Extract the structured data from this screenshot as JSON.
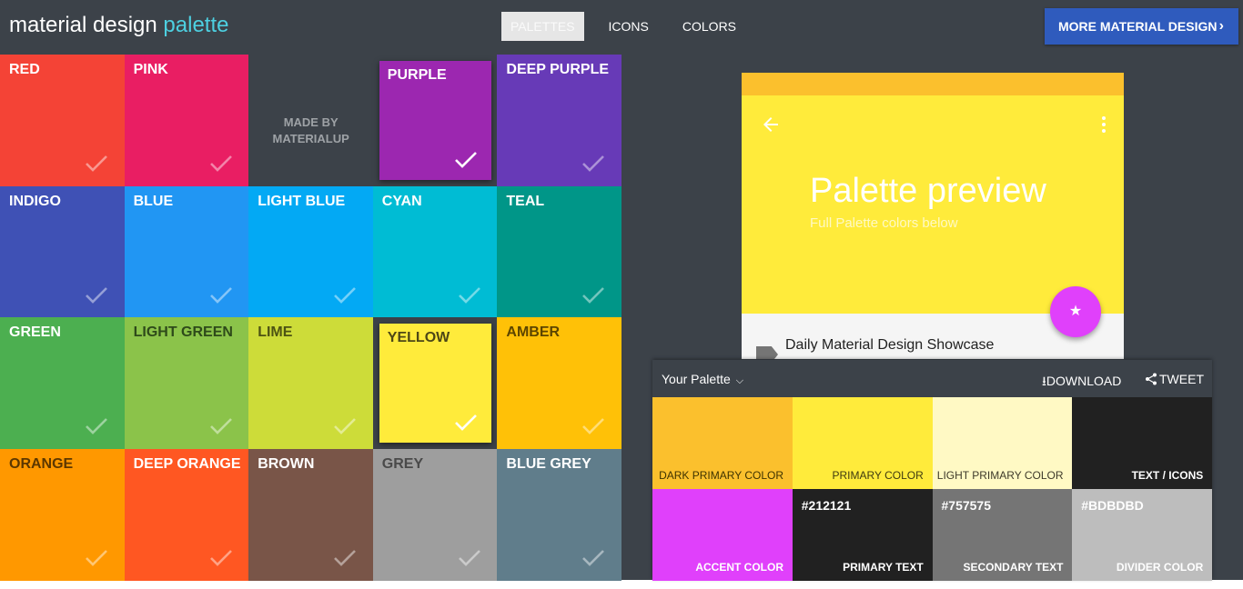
{
  "header": {
    "logo_main": "material design",
    "logo_accent": "palette",
    "nav": [
      {
        "label": "PALETTES",
        "active": true
      },
      {
        "label": "ICONS",
        "active": false
      },
      {
        "label": "COLORS",
        "active": false
      }
    ],
    "more_button": "MORE MATERIAL DESIGN"
  },
  "grid": {
    "tiles": [
      {
        "name": "RED",
        "color": "#f44336",
        "text_color": "#ffffff",
        "selected": false
      },
      {
        "name": "PINK",
        "color": "#e91e63",
        "text_color": "#ffffff",
        "selected": false
      },
      {
        "name": "",
        "color": "#3c4249",
        "text_color": "#9ea2a6",
        "selected": false,
        "made_by": [
          "MADE BY",
          "MATERIALUP"
        ]
      },
      {
        "name": "PURPLE",
        "color": "#9c27b0",
        "text_color": "#ffffff",
        "selected": true
      },
      {
        "name": "DEEP PURPLE",
        "color": "#673ab7",
        "text_color": "#ffffff",
        "selected": false
      },
      {
        "name": "INDIGO",
        "color": "#3f51b5",
        "text_color": "#ffffff",
        "selected": false
      },
      {
        "name": "BLUE",
        "color": "#2196f3",
        "text_color": "#ffffff",
        "selected": false
      },
      {
        "name": "LIGHT BLUE",
        "color": "#03a9f4",
        "text_color": "#ffffff",
        "selected": false
      },
      {
        "name": "CYAN",
        "color": "#00bcd4",
        "text_color": "#ffffff",
        "selected": false
      },
      {
        "name": "TEAL",
        "color": "#009688",
        "text_color": "#ffffff",
        "selected": false
      },
      {
        "name": "GREEN",
        "color": "#4caf50",
        "text_color": "#ffffff",
        "selected": false
      },
      {
        "name": "LIGHT GREEN",
        "color": "#8bc34a",
        "text_color": "#2e4a1a",
        "selected": false
      },
      {
        "name": "LIME",
        "color": "#cddc39",
        "text_color": "#4d5313",
        "selected": false
      },
      {
        "name": "YELLOW",
        "color": "#ffeb3b",
        "text_color": "#4d4716",
        "selected": true
      },
      {
        "name": "AMBER",
        "color": "#ffc107",
        "text_color": "#5c4500",
        "selected": false
      },
      {
        "name": "ORANGE",
        "color": "#ff9800",
        "text_color": "#5c3700",
        "selected": false
      },
      {
        "name": "DEEP ORANGE",
        "color": "#ff5722",
        "text_color": "#ffffff",
        "selected": false
      },
      {
        "name": "BROWN",
        "color": "#795548",
        "text_color": "#ffffff",
        "selected": false
      },
      {
        "name": "GREY",
        "color": "#9e9e9e",
        "text_color": "#4a4a4a",
        "selected": false
      },
      {
        "name": "BLUE GREY",
        "color": "#607d8b",
        "text_color": "#ffffff",
        "selected": false
      }
    ]
  },
  "preview": {
    "status_color": "#fbc02d",
    "primary_color": "#ffeb3b",
    "title": "Palette preview",
    "subtitle": "Full Palette colors below",
    "fab_color": "#e040fb",
    "list_item": "Daily Material Design Showcase"
  },
  "palette": {
    "title": "Your Palette",
    "download": "DOWNLOAD",
    "tweet": "TWEET",
    "swatches": [
      {
        "label": "DARK PRIMARY COLOR",
        "hex": "",
        "color": "#fbc02d",
        "text_color": "#3e3200"
      },
      {
        "label": "PRIMARY COLOR",
        "hex": "",
        "color": "#ffeb3b",
        "text_color": "#3e3a10"
      },
      {
        "label": "LIGHT PRIMARY COLOR",
        "hex": "",
        "color": "#fff9c4",
        "text_color": "#3e3a2a"
      },
      {
        "label": "TEXT / ICONS",
        "hex": "",
        "color": "#212121",
        "text_color": "#ffffff"
      },
      {
        "label": "ACCENT COLOR",
        "hex": "",
        "color": "#e040fb",
        "text_color": "#ffffff"
      },
      {
        "label": "PRIMARY TEXT",
        "hex": "#212121",
        "color": "#212121",
        "text_color": "#ffffff"
      },
      {
        "label": "SECONDARY TEXT",
        "hex": "#757575",
        "color": "#757575",
        "text_color": "#ffffff"
      },
      {
        "label": "DIVIDER COLOR",
        "hex": "#BDBDBD",
        "color": "#bdbdbd",
        "text_color": "#ffffff"
      }
    ]
  }
}
